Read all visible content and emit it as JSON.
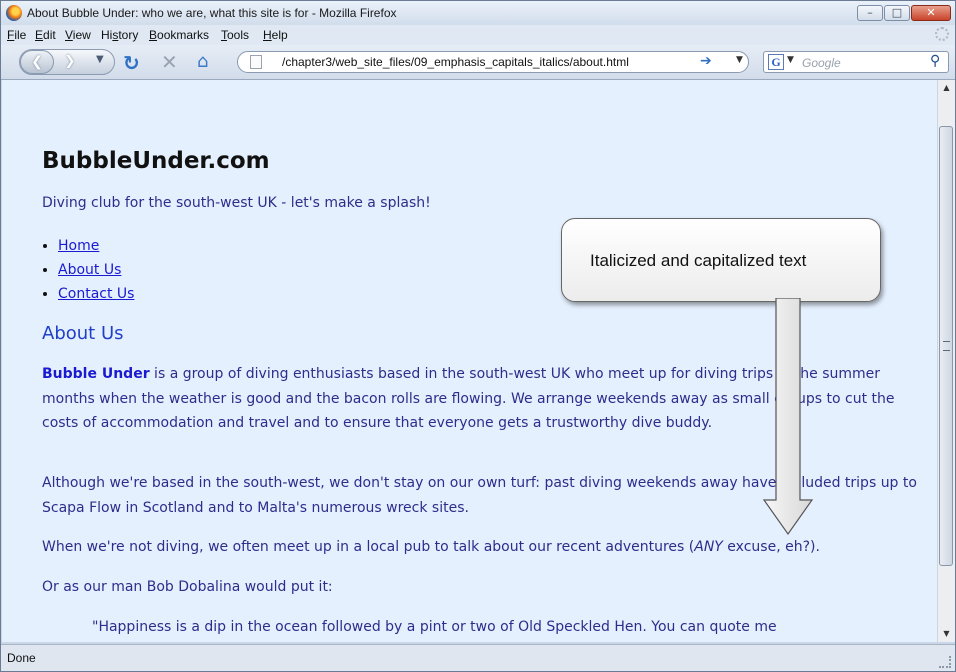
{
  "window": {
    "title": "About Bubble Under: who we are, what this site is for - Mozilla Firefox"
  },
  "menubar": {
    "items": [
      {
        "acc": "F",
        "rest": "ile"
      },
      {
        "acc": "E",
        "rest": "dit"
      },
      {
        "acc": "V",
        "rest": "iew"
      },
      {
        "pre": "Hi",
        "acc": "s",
        "rest": "tory"
      },
      {
        "acc": "B",
        "rest": "ookmarks"
      },
      {
        "acc": "T",
        "rest": "ools"
      },
      {
        "acc": "H",
        "rest": "elp"
      }
    ]
  },
  "navbar": {
    "url": "/chapter3/web_site_files/09_emphasis_capitals_italics/about.html",
    "search_placeholder": "Google",
    "search_engine_letter": "G"
  },
  "page": {
    "site_title": "BubbleUnder.com",
    "tagline": "Diving club for the south-west UK - let's make a splash!",
    "nav": [
      "Home",
      "About Us",
      "Contact Us"
    ],
    "heading": "About Us",
    "p1_strong": "Bubble Under",
    "p1_rest": " is a group of diving enthusiasts based in the south-west UK who meet up for diving trips in the summer months when the weather is good and the bacon rolls are flowing. We arrange weekends away as small groups to cut the costs of accommodation and travel and to ensure that everyone gets a trustworthy dive buddy.",
    "p2": "Although we're based in the south-west, we don't stay on our own turf: past diving weekends away have included trips up to Scapa Flow in Scotland and to Malta's numerous wreck sites.",
    "p3_before": "When we're not diving, we often meet up in a local pub to talk about our recent adventures (",
    "p3_em": "ANY",
    "p3_after": " excuse, eh?).",
    "p4": "Or as our man Bob Dobalina would put it:",
    "quote": "\"Happiness is a dip in the ocean followed by a pint or two of Old Speckled Hen. You can quote me"
  },
  "callout": {
    "text": "Italicized and capitalized text"
  },
  "statusbar": {
    "text": "Done"
  }
}
